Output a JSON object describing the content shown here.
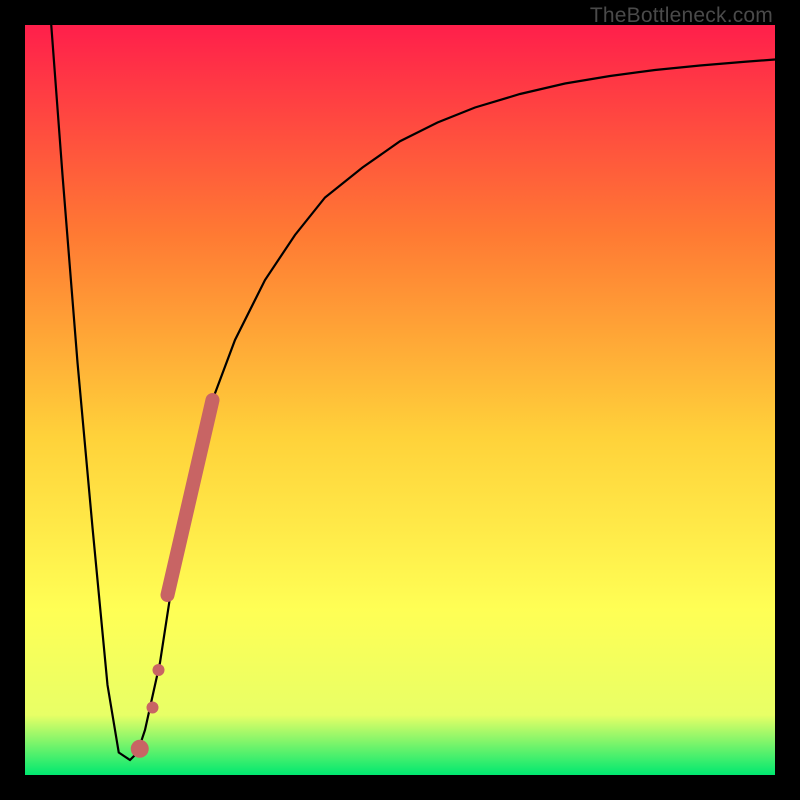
{
  "watermark": "TheBottleneck.com",
  "colors": {
    "frame": "#000000",
    "gradient_top": "#ff1f4b",
    "gradient_mid_upper": "#ff7a33",
    "gradient_mid": "#ffd23a",
    "gradient_mid_lower": "#ffff55",
    "gradient_lower": "#e8ff66",
    "gradient_bottom": "#00e870",
    "curve": "#000000",
    "marker": "#c86464"
  },
  "chart_data": {
    "type": "line",
    "title": "",
    "xlabel": "",
    "ylabel": "",
    "xlim": [
      0,
      100
    ],
    "ylim": [
      0,
      100
    ],
    "series": [
      {
        "name": "bottleneck-curve",
        "x": [
          3.5,
          5,
          7,
          9,
          11,
          12.5,
          14,
          15,
          16,
          18,
          20,
          22,
          25,
          28,
          32,
          36,
          40,
          45,
          50,
          55,
          60,
          66,
          72,
          78,
          84,
          90,
          96,
          100
        ],
        "y": [
          100,
          80,
          55,
          33,
          12,
          3,
          2,
          3,
          6,
          15,
          28,
          38,
          50,
          58,
          66,
          72,
          77,
          81,
          84.5,
          87,
          89,
          90.8,
          92.2,
          93.2,
          94,
          94.6,
          95.1,
          95.4
        ]
      }
    ],
    "markers": [
      {
        "name": "thick-marker-segment",
        "x_start": 19,
        "y_start": 24,
        "x_end": 25,
        "y_end": 50,
        "width": 14
      },
      {
        "name": "dot-1",
        "cx": 17.8,
        "cy": 14,
        "r": 6
      },
      {
        "name": "dot-2",
        "cx": 17.0,
        "cy": 9,
        "r": 6
      },
      {
        "name": "dot-3",
        "cx": 15.3,
        "cy": 3.5,
        "r": 9
      }
    ]
  }
}
